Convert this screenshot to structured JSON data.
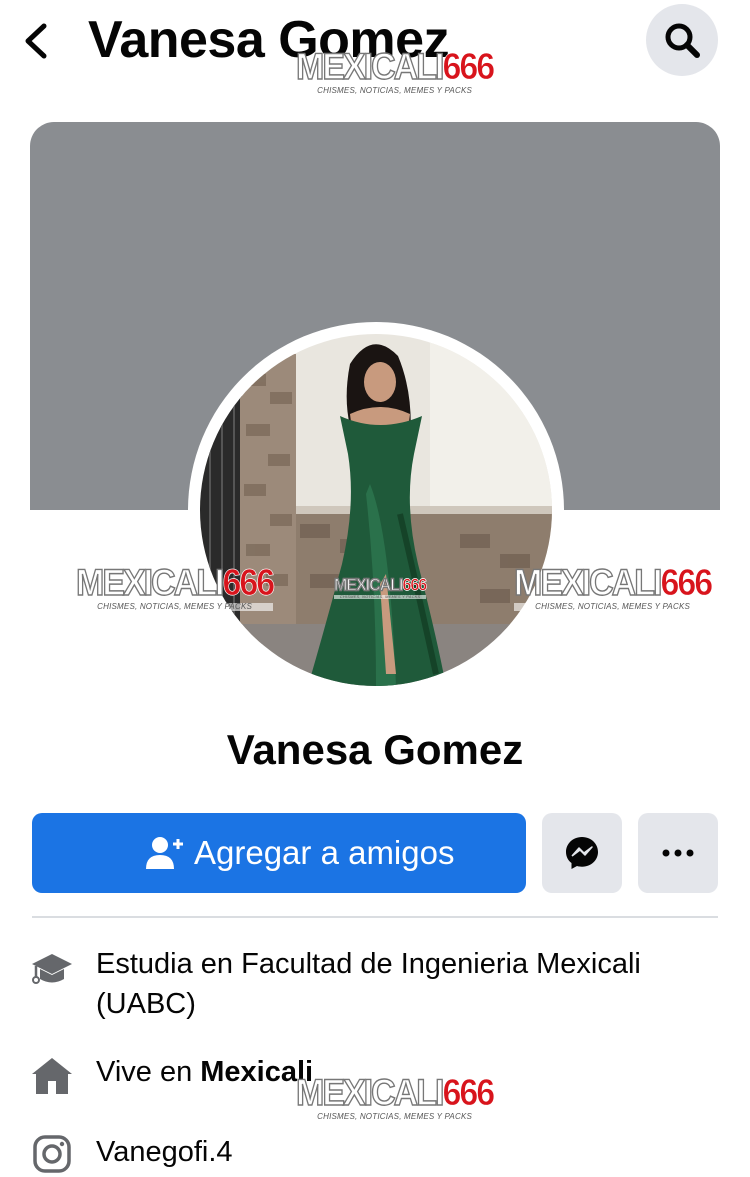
{
  "header": {
    "title": "Vanesa Gomez",
    "back_icon": "chevron-left-icon",
    "search_icon": "search-icon"
  },
  "profile": {
    "name": "Vanesa Gomez",
    "cover_color": "#8a8d91"
  },
  "actions": {
    "add_friend_label": "Agregar a amigos",
    "add_friend_icon": "add-person-icon",
    "messenger_icon": "messenger-icon",
    "more_icon": "more-dots-icon",
    "accent_color": "#1b74e4"
  },
  "intro": {
    "education": {
      "icon": "graduation-cap-icon",
      "text": "Estudia en Facultad de Ingenieria Mexicali (UABC)"
    },
    "location": {
      "icon": "home-icon",
      "prefix": "Vive en ",
      "place": "Mexicali"
    },
    "instagram": {
      "icon": "instagram-icon",
      "handle": "Vanegofi.4"
    }
  },
  "watermark": {
    "brand_white": "MEXICALI",
    "brand_red": "666",
    "tagline": "CHISMES, NOTICIAS, MEMES Y PACKS"
  }
}
